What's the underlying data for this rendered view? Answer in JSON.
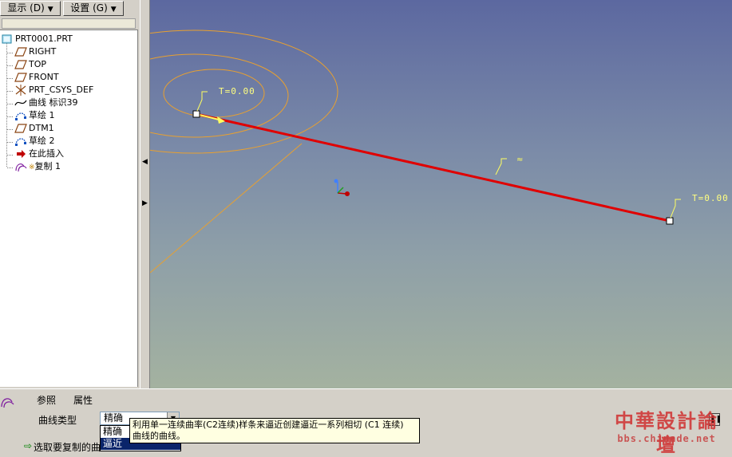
{
  "menu": {
    "display_label": "显示 (D)",
    "settings_label": "设置 (G)"
  },
  "tree": {
    "items": [
      {
        "label": "PRT0001.PRT",
        "icon": "part-icon"
      },
      {
        "label": "RIGHT",
        "icon": "datum-plane-icon"
      },
      {
        "label": "TOP",
        "icon": "datum-plane-icon"
      },
      {
        "label": "FRONT",
        "icon": "datum-plane-icon"
      },
      {
        "label": "PRT_CSYS_DEF",
        "icon": "csys-icon"
      },
      {
        "label": "曲线 标识39",
        "icon": "curve-icon"
      },
      {
        "label": "草绘 1",
        "icon": "sketch-icon"
      },
      {
        "label": "DTM1",
        "icon": "datum-plane-icon"
      },
      {
        "label": "草绘 2",
        "icon": "sketch-icon"
      },
      {
        "label": "在此插入",
        "icon": "insert-here-icon"
      },
      {
        "label": "复制 1",
        "icon": "copy-feature-icon"
      }
    ]
  },
  "viewport": {
    "label_start": "T=0.00",
    "label_end": "T=0.00",
    "curve_color": "#e00000",
    "contour_color": "#e8a030",
    "label_color": "#ffff80"
  },
  "dashboard": {
    "tab_refs": "参照",
    "tab_props": "属性",
    "curve_type_label": "曲线类型",
    "curve_type_value": "精确",
    "options": [
      "精确",
      "逼近"
    ],
    "selected_option": "逼近",
    "tooltip_line1": "利用单一连续曲率(C2连续)样条来逼近创建逼近一系列相切 (C1 连续)",
    "tooltip_line2": "曲线的曲线。",
    "status_text": "选取要复制的曲"
  },
  "watermark": {
    "title": "中華設計論壇",
    "url": "bbs.chinade.net"
  }
}
